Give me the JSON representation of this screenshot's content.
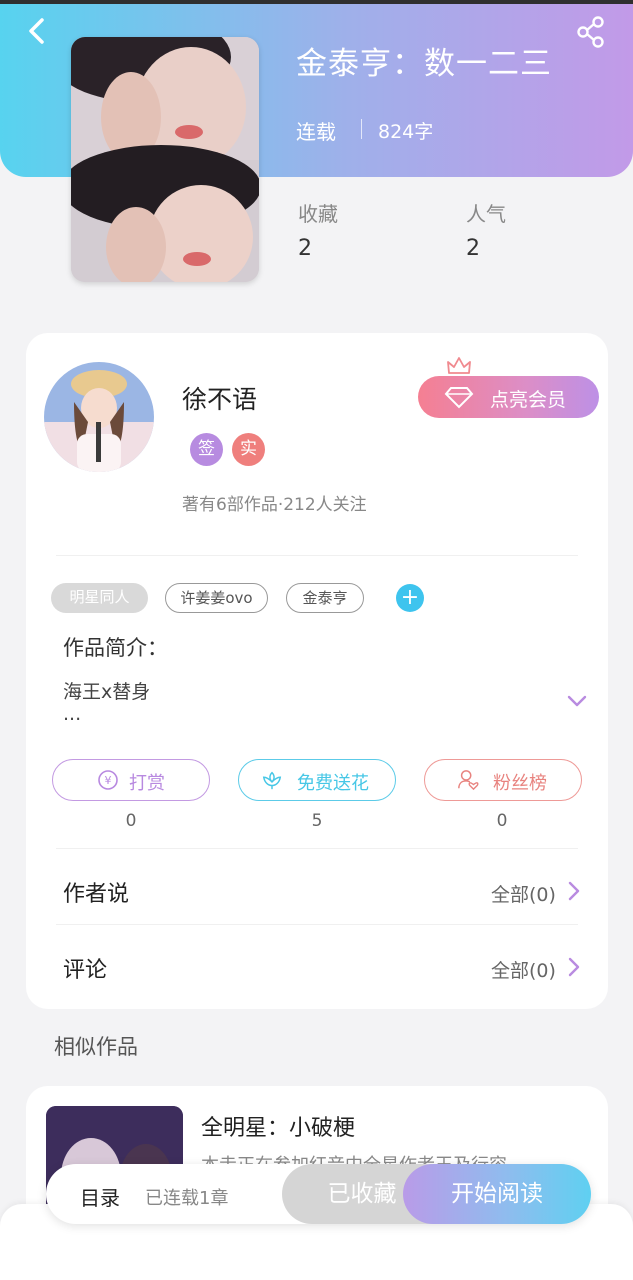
{
  "colors": {
    "header_start": "#57d3ef",
    "header_end": "#c29ae8",
    "accent_blue": "#3ec4ee",
    "reward_purple": "#b889e0",
    "flower_cyan": "#47c7e6",
    "fans_red": "#e8837f",
    "vip_pink": "#f57f92"
  },
  "header": {
    "back_icon": "chevron-left-icon",
    "share_icon": "share-icon",
    "title": "金泰亨：数一二三",
    "status": "连载",
    "word_count": "824字"
  },
  "stats": [
    {
      "label": "收藏",
      "value": "2"
    },
    {
      "label": "人气",
      "value": "2"
    }
  ],
  "author": {
    "name": "徐不语",
    "badges": [
      "签",
      "实"
    ],
    "vip_label": "点亮会员",
    "meta": "著有6部作品·212人关注"
  },
  "tags": [
    "明星同人",
    "许姜姜ovo",
    "金泰亨"
  ],
  "intro": {
    "label": "作品简介：",
    "text": "海王x替身",
    "more": "..."
  },
  "actions": [
    {
      "label": "打赏",
      "count": "0",
      "icon": "yen-coin-icon"
    },
    {
      "label": "免费送花",
      "count": "5",
      "icon": "flower-icon"
    },
    {
      "label": "粉丝榜",
      "count": "0",
      "icon": "fan-user-icon"
    }
  ],
  "rows": [
    {
      "label": "作者说",
      "all": "全部(0)"
    },
    {
      "label": "评论",
      "all": "全部(0)"
    }
  ],
  "similar": {
    "title": "相似作品",
    "items": [
      {
        "name": "全明星：小破梗",
        "desc": "本走正在参加红音中全星作者王及行容"
      }
    ]
  },
  "bottom": {
    "toc": "目录",
    "toc_sub": "已连载1章",
    "collected": "已收藏",
    "read": "开始阅读"
  }
}
